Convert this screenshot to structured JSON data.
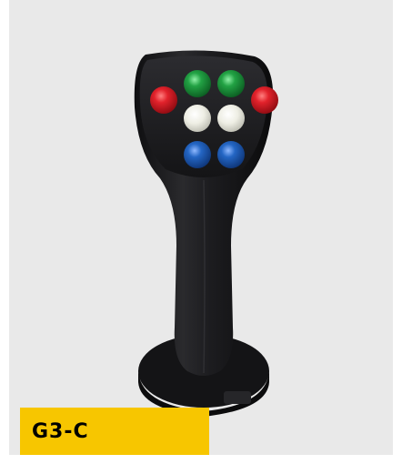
{
  "product": {
    "model_label": "G3-C",
    "button_colors": [
      "red",
      "green",
      "green",
      "red",
      "white",
      "white",
      "blue",
      "blue"
    ]
  },
  "colors": {
    "background": "#e9e9e9",
    "banner": "#f7c600",
    "grip": "#1d1d1f",
    "button_red": "#d8141e",
    "button_green": "#1f9a3a",
    "button_white": "#f2f2ea",
    "button_blue": "#1f5fb8"
  }
}
